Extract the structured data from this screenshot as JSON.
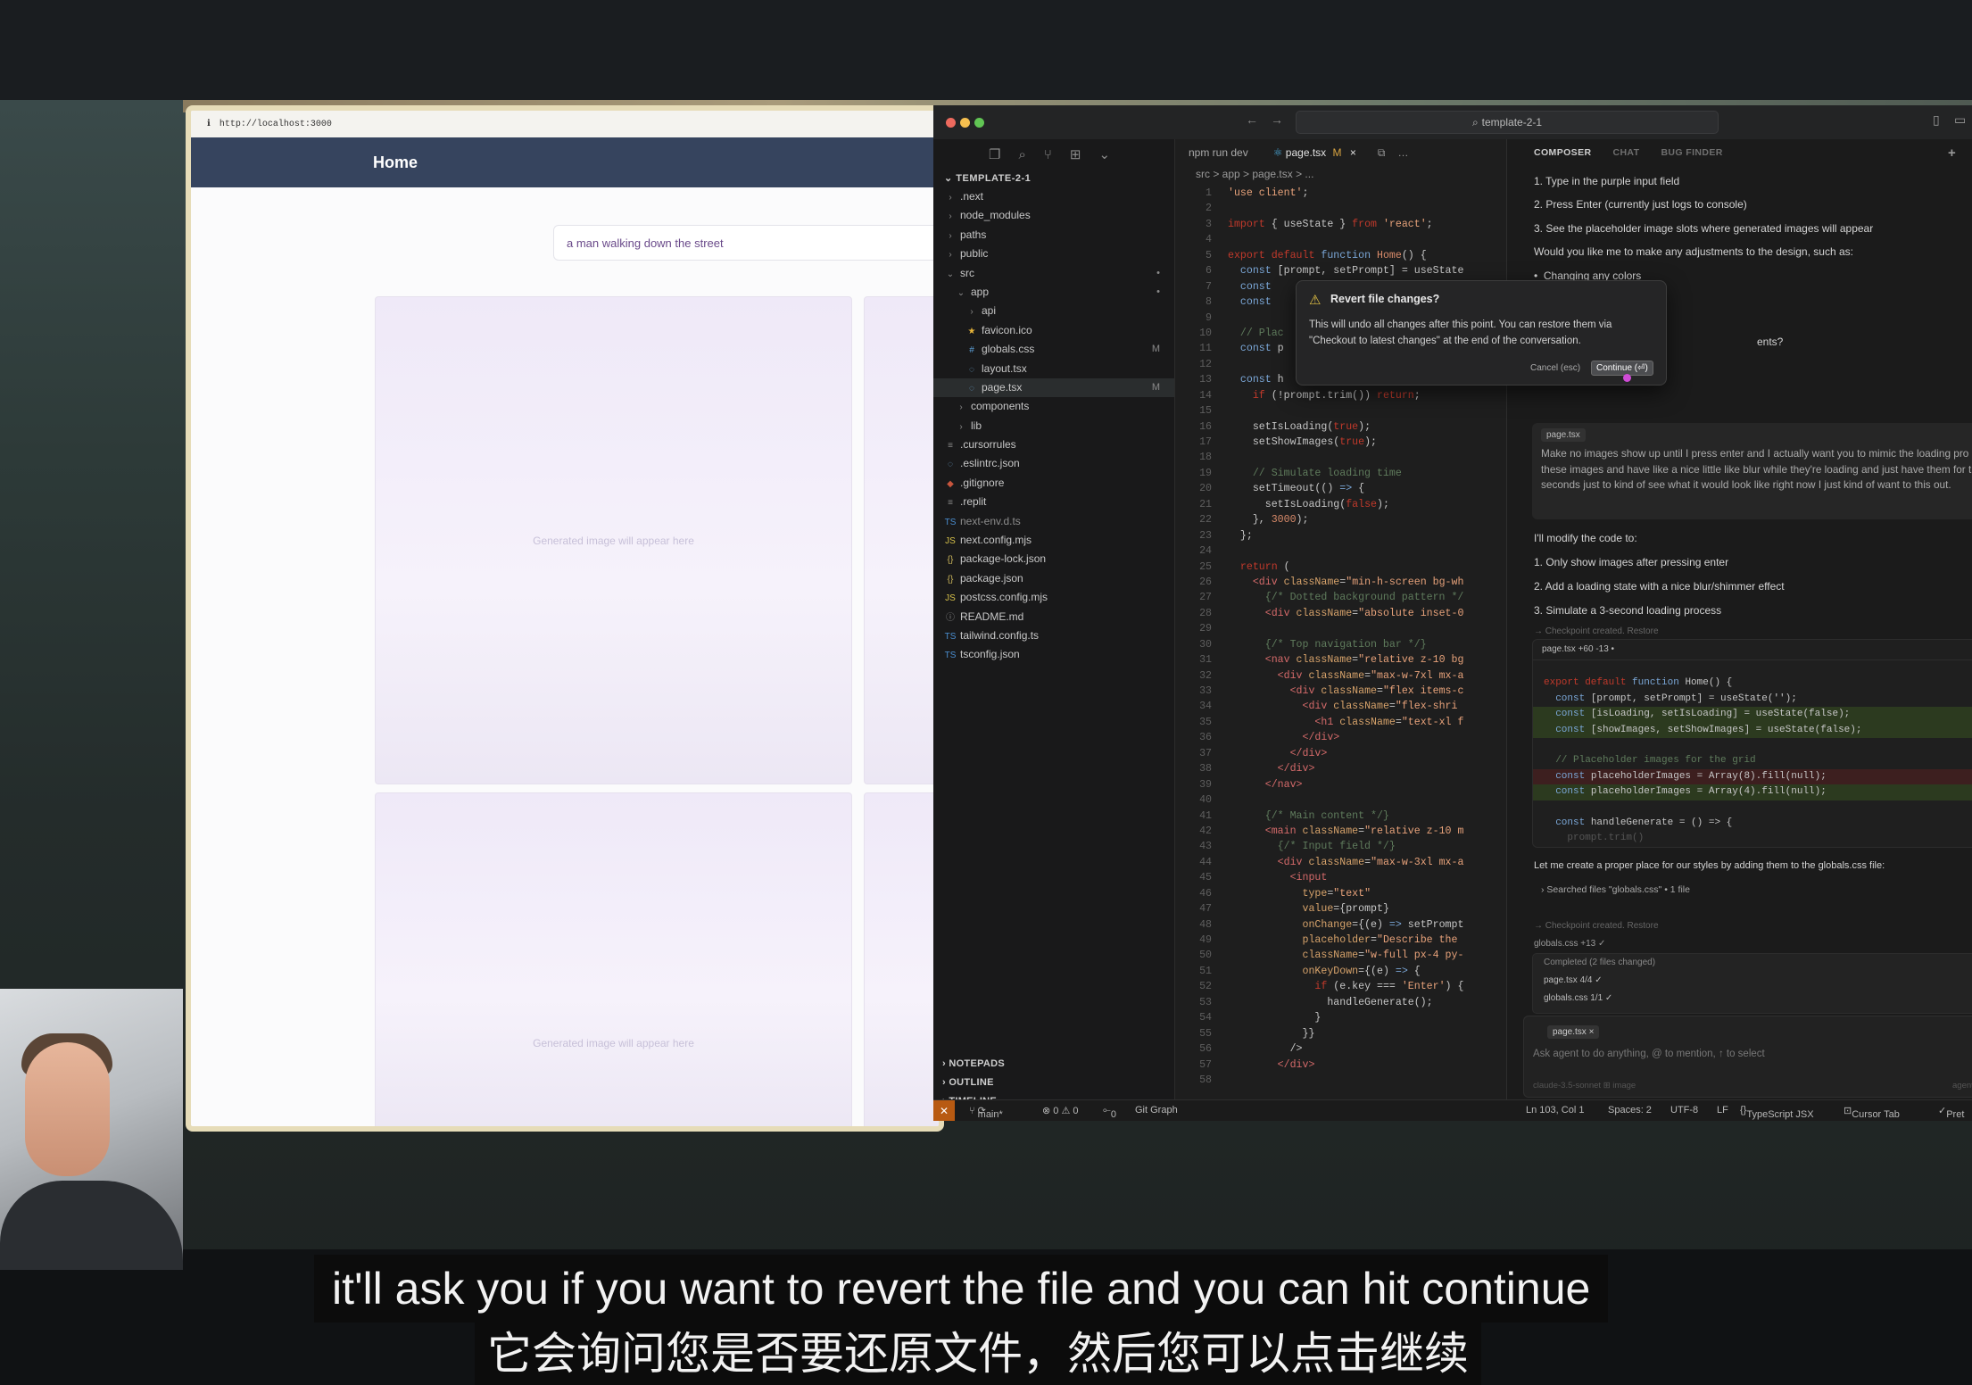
{
  "browser": {
    "url": "http://localhost:3000",
    "nav_title": "Home",
    "prompt_value": "a man walking down the street",
    "placeholder_text_1": "Generated image will appear here",
    "placeholder_text_2": "Generated image will appear here"
  },
  "editor": {
    "search_text": "template-2-1",
    "tabs": [
      "npm run dev",
      "page.tsx",
      "M"
    ],
    "breadcrumb": "src > app > page.tsx > ...",
    "explorer_title": "TEMPLATE-2-1",
    "files": [
      {
        "label": ".next",
        "icon": "chevron-right",
        "indent": 0
      },
      {
        "label": "node_modules",
        "icon": "chevron-right",
        "indent": 0
      },
      {
        "label": "paths",
        "icon": "chevron-right",
        "indent": 0
      },
      {
        "label": "public",
        "icon": "chevron-right",
        "indent": 0
      },
      {
        "label": "src",
        "icon": "chevron-down",
        "indent": 0,
        "mark": "•"
      },
      {
        "label": "app",
        "icon": "chevron-down",
        "indent": 1,
        "mark": "•"
      },
      {
        "label": "api",
        "icon": "chevron-right",
        "indent": 2
      },
      {
        "label": "favicon.ico",
        "icon": "star",
        "indent": 2
      },
      {
        "label": "globals.css",
        "icon": "hash",
        "indent": 2,
        "mark": "M"
      },
      {
        "label": "layout.tsx",
        "icon": "circle",
        "indent": 2
      },
      {
        "label": "page.tsx",
        "icon": "circle",
        "indent": 2,
        "mark": "M",
        "selected": true
      },
      {
        "label": "components",
        "icon": "chevron-right",
        "indent": 1
      },
      {
        "label": "lib",
        "icon": "chevron-right",
        "indent": 1
      },
      {
        "label": ".cursorrules",
        "icon": "lines",
        "indent": 0
      },
      {
        "label": ".eslintrc.json",
        "icon": "circle",
        "indent": 0
      },
      {
        "label": ".gitignore",
        "icon": "diamond",
        "indent": 0
      },
      {
        "label": ".replit",
        "icon": "lines",
        "indent": 0
      },
      {
        "label": "next-env.d.ts",
        "icon": "ts",
        "indent": 0,
        "dim": true
      },
      {
        "label": "next.config.mjs",
        "icon": "js",
        "indent": 0
      },
      {
        "label": "package-lock.json",
        "icon": "braces",
        "indent": 0
      },
      {
        "label": "package.json",
        "icon": "braces",
        "indent": 0
      },
      {
        "label": "postcss.config.mjs",
        "icon": "js",
        "indent": 0
      },
      {
        "label": "README.md",
        "icon": "info",
        "indent": 0
      },
      {
        "label": "tailwind.config.ts",
        "icon": "ts",
        "indent": 0
      },
      {
        "label": "tsconfig.json",
        "icon": "ts",
        "indent": 0
      }
    ],
    "sections": [
      "NOTEPADS",
      "OUTLINE",
      "TIMELINE"
    ],
    "status": {
      "branch": "main*",
      "problems": "⊗ 0 ⚠ 0",
      "ports": "0",
      "git_graph": "Git Graph",
      "position": "Ln 103, Col 1",
      "spaces": "Spaces: 2",
      "encoding": "UTF-8",
      "eol": "LF",
      "language": "TypeScript JSX",
      "cursor_tab": "Cursor Tab",
      "prettier": "Pret"
    }
  },
  "composer": {
    "tabs": [
      "COMPOSER",
      "CHAT",
      "BUG FINDER"
    ],
    "steps": [
      "1. Type in the purple input field",
      "2. Press Enter (currently just logs to console)",
      "3. See the placeholder image slots where generated images will appear"
    ],
    "question": "Would you like me to make any adjustments to the design, such as:",
    "bullet": "Changing any colors",
    "partial": "ents?",
    "user_chip": "page.tsx",
    "user_message": "Make no images show up until I press enter and I actually want you to mimic the loading pro of these images and have like a nice little like blur while they're loading and just have them for three seconds just to kind of see what it would look like right now I just kind of want to this out.",
    "modify_intro": "I'll modify the code to:",
    "modify_steps": [
      "1. Only show images after pressing enter",
      "2. Add a loading state with a nice blur/shimmer effect",
      "3. Simulate a 3-second loading process"
    ],
    "checkpoint_1": "→ Checkpoint created. Restore",
    "diff_header": "page.tsx +60 -13 •",
    "css_intro": "Let me create a proper place for our styles by adding them to the globals.css file:",
    "searched": "Searched files \"globals.css\" • 1 file",
    "checkpoint_2": "→ Checkpoint created. Restore",
    "globals_card": "globals.css +13 ✓",
    "completed": "Completed (2 files changed)",
    "completed_files": [
      "page.tsx 4/4 ✓",
      "globals.css 1/1 ✓"
    ],
    "input_chip": "page.tsx ×",
    "input_placeholder": "Ask agent to do anything, @ to mention, ↑ to select",
    "model": "claude-3.5-sonnet  ⊞ image",
    "agent": "agent"
  },
  "dialog": {
    "title": "Revert file changes?",
    "body": "This will undo all changes after this point. You can restore them via \"Checkout to latest changes\" at the end of the conversation.",
    "cancel": "Cancel (esc)",
    "continue": "Continue (⏎)"
  },
  "subtitles": {
    "en": "it'll ask you if you want to revert the file and you can hit continue",
    "zh": "它会询问您是否要还原文件，然后您可以点击继续"
  }
}
